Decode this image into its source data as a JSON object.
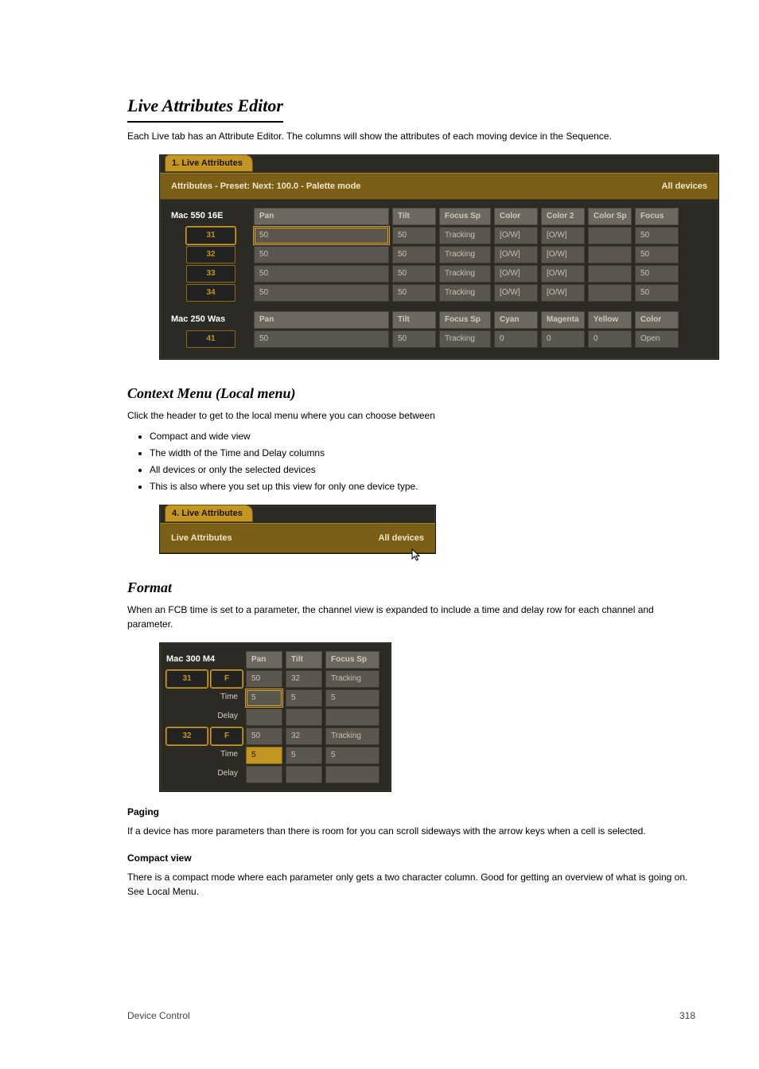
{
  "headings": {
    "section": "Live Attributes Editor",
    "sub": "Context Menu (Local menu)",
    "format": "Format"
  },
  "intro": "Each Live tab has an Attribute Editor. The columns will show the attributes of each moving device in the Sequence.",
  "context_intro": "Click the header to get to the local menu where you can choose between",
  "context_items": [
    "Compact and wide view",
    "The width of the Time and Delay columns",
    "All devices or only the selected devices",
    "This is also where you set up this view for only one device type."
  ],
  "img1": {
    "tab": "1. Live Attributes",
    "bar_left": "Attributes - Preset:  Next: 100.0 - Palette mode",
    "bar_right": "All devices",
    "group1": {
      "label": "Mac 550 16E",
      "headers": [
        "Pan",
        "Tilt",
        "Focus Sp",
        "Color",
        "Color 2",
        "Color Sp",
        "Focus"
      ],
      "rows": [
        {
          "ch": "31",
          "vals": [
            "50",
            "50",
            "Tracking",
            "[O/W]",
            "[O/W]",
            "",
            "50"
          ],
          "sel": true
        },
        {
          "ch": "32",
          "vals": [
            "50",
            "50",
            "Tracking",
            "[O/W]",
            "[O/W]",
            "",
            "50"
          ]
        },
        {
          "ch": "33",
          "vals": [
            "50",
            "50",
            "Tracking",
            "[O/W]",
            "[O/W]",
            "",
            "50"
          ]
        },
        {
          "ch": "34",
          "vals": [
            "50",
            "50",
            "Tracking",
            "[O/W]",
            "[O/W]",
            "",
            "50"
          ]
        }
      ]
    },
    "group2": {
      "label": "Mac 250 Was",
      "headers": [
        "Pan",
        "Tilt",
        "Focus Sp",
        "Cyan",
        "Magenta",
        "Yellow",
        "Color"
      ],
      "rows": [
        {
          "ch": "41",
          "vals": [
            "50",
            "50",
            "Tracking",
            "0",
            "0",
            "0",
            "Open"
          ]
        }
      ]
    }
  },
  "img2": {
    "tab": "4. Live Attributes",
    "bar_left": "Live Attributes",
    "bar_right": "All devices"
  },
  "img3": {
    "label": "Mac 300 M4",
    "headers": [
      "Pan",
      "Tilt",
      "Focus Sp"
    ],
    "rows": [
      {
        "ch": "31",
        "f": "F",
        "vals": [
          "50",
          "32",
          "Tracking"
        ],
        "time": [
          "5",
          "5",
          "5"
        ],
        "delay": [
          "",
          "",
          ""
        ],
        "sel": true,
        "time_sel": 0
      },
      {
        "ch": "32",
        "f": "F",
        "vals": [
          "50",
          "32",
          "Tracking"
        ],
        "time": [
          "5",
          "5",
          "5"
        ],
        "delay": [
          "",
          "",
          ""
        ],
        "sel": true,
        "time_hl": 0
      }
    ]
  },
  "format_para": "When an FCB time is set to a parameter, the channel view is expanded to include a time and delay row for each channel and parameter.",
  "paging_para": "If a device has more parameters than there is room for you can scroll sideways with the arrow keys when a cell is selected.",
  "compact_para": "There is a compact mode where each parameter only gets a two character column. Good for getting an overview of what is going on. See Local Menu.",
  "compact_head": "Compact view",
  "paging_head": "Paging",
  "footer_left": "Device Control",
  "footer_right": "318"
}
